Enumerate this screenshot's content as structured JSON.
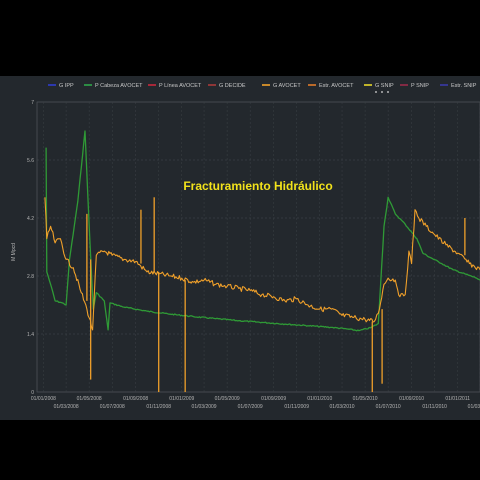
{
  "chart_data": {
    "type": "line",
    "title": "",
    "ylabel": "M Mpcd",
    "xlabel": "",
    "ylim": [
      0,
      7
    ],
    "yticks": [
      0,
      1.4,
      2.8,
      4.2,
      5.6,
      7
    ],
    "ytick_labels": [
      "0",
      "1.4",
      "2.8",
      "4.2",
      "5.6",
      "7"
    ],
    "xlim": [
      "2007-12-15",
      "2011-03-01"
    ],
    "xticks_row1": [
      "01/01/2008",
      "01/05/2008",
      "01/09/2008",
      "01/01/2009",
      "01/05/2009",
      "01/09/2009",
      "01/01/2010",
      "01/05/2010",
      "01/09/2010",
      "01/01/2011"
    ],
    "xticks_row2": [
      "01/03/2008",
      "01/07/2008",
      "01/11/2008",
      "01/03/2009",
      "01/07/2009",
      "01/11/2009",
      "01/03/2010",
      "01/07/2010",
      "01/11/2010",
      "01/03/2011"
    ],
    "grid": true,
    "legend_position": "top",
    "legend": [
      {
        "name": "G IPP",
        "color": "#2f3ccf"
      },
      {
        "name": "P Cabeza AVOCET",
        "color": "#2ea64a"
      },
      {
        "name": "P Línea AVOCET",
        "color": "#c8283c"
      },
      {
        "name": "G DECIDE",
        "color": "#a93a3a"
      },
      {
        "name": "G AVOCET",
        "color": "#f0a02a"
      },
      {
        "name": "Estr. AVOCET",
        "color": "#e07a2a"
      },
      {
        "name": "G SNIP",
        "color": "#e6d82a"
      },
      {
        "name": "P SNIP",
        "color": "#9a2a4a"
      },
      {
        "name": "Estr. SNIP",
        "color": "#3a3aa8"
      }
    ],
    "annotation": "Fracturamiento Hidráulico",
    "series": [
      {
        "name": "P Cabeza AVOCET",
        "color": "#2f9a36",
        "points": [
          [
            "2008-01-08",
            5.9
          ],
          [
            "2008-01-10",
            2.9
          ],
          [
            "2008-01-20",
            2.6
          ],
          [
            "2008-02-01",
            2.2
          ],
          [
            "2008-02-20",
            2.15
          ],
          [
            "2008-03-01",
            2.1
          ],
          [
            "2008-03-10",
            3.2
          ],
          [
            "2008-04-01",
            4.6
          ],
          [
            "2008-04-20",
            6.3
          ],
          [
            "2008-05-01",
            4.0
          ],
          [
            "2008-05-12",
            2.0
          ],
          [
            "2008-05-20",
            2.4
          ],
          [
            "2008-06-10",
            2.2
          ],
          [
            "2008-06-20",
            1.5
          ],
          [
            "2008-06-25",
            2.15
          ],
          [
            "2008-08-01",
            2.05
          ],
          [
            "2008-10-01",
            1.95
          ],
          [
            "2008-12-01",
            1.88
          ],
          [
            "2009-02-01",
            1.82
          ],
          [
            "2009-04-01",
            1.77
          ],
          [
            "2009-06-01",
            1.72
          ],
          [
            "2009-08-01",
            1.68
          ],
          [
            "2009-10-01",
            1.64
          ],
          [
            "2009-12-01",
            1.6
          ],
          [
            "2010-02-01",
            1.56
          ],
          [
            "2010-03-15",
            1.52
          ],
          [
            "2010-04-15",
            1.48
          ],
          [
            "2010-05-15",
            1.55
          ],
          [
            "2010-06-05",
            1.65
          ],
          [
            "2010-06-20",
            4.0
          ],
          [
            "2010-07-01",
            4.7
          ],
          [
            "2010-07-20",
            4.3
          ],
          [
            "2010-08-15",
            4.05
          ],
          [
            "2010-09-15",
            3.7
          ],
          [
            "2010-10-01",
            3.35
          ],
          [
            "2010-10-20",
            3.25
          ],
          [
            "2010-11-20",
            3.1
          ],
          [
            "2010-12-20",
            2.95
          ],
          [
            "2011-01-20",
            2.85
          ],
          [
            "2011-02-20",
            2.75
          ],
          [
            "2011-03-01",
            2.7
          ]
        ]
      },
      {
        "name": "G AVOCET",
        "color": "#f0a02a",
        "points": [
          [
            "2008-01-05",
            4.7
          ],
          [
            "2008-01-10",
            3.7
          ],
          [
            "2008-01-20",
            4.0
          ],
          [
            "2008-02-01",
            3.6
          ],
          [
            "2008-02-15",
            3.7
          ],
          [
            "2008-03-01",
            3.2
          ],
          [
            "2008-03-20",
            3.0
          ],
          [
            "2008-04-10",
            2.4
          ],
          [
            "2008-04-25",
            2.0
          ],
          [
            "2008-05-10",
            1.5
          ],
          [
            "2008-05-20",
            3.3
          ],
          [
            "2008-06-10",
            3.4
          ],
          [
            "2008-07-01",
            3.3
          ],
          [
            "2008-08-01",
            3.2
          ],
          [
            "2008-09-01",
            3.15
          ],
          [
            "2008-10-01",
            2.9
          ],
          [
            "2008-11-01",
            2.85
          ],
          [
            "2008-12-01",
            2.8
          ],
          [
            "2009-01-01",
            2.75
          ],
          [
            "2009-02-01",
            2.65
          ],
          [
            "2009-03-01",
            2.7
          ],
          [
            "2009-04-01",
            2.6
          ],
          [
            "2009-05-01",
            2.55
          ],
          [
            "2009-06-01",
            2.5
          ],
          [
            "2009-07-01",
            2.45
          ],
          [
            "2009-08-01",
            2.35
          ],
          [
            "2009-09-01",
            2.3
          ],
          [
            "2009-10-01",
            2.2
          ],
          [
            "2009-11-01",
            2.25
          ],
          [
            "2009-12-01",
            2.1
          ],
          [
            "2010-01-01",
            2.0
          ],
          [
            "2010-02-01",
            2.0
          ],
          [
            "2010-03-01",
            1.85
          ],
          [
            "2010-04-01",
            1.8
          ],
          [
            "2010-05-01",
            1.75
          ],
          [
            "2010-05-25",
            1.7
          ],
          [
            "2010-06-05",
            1.9
          ],
          [
            "2010-06-20",
            2.6
          ],
          [
            "2010-07-01",
            2.75
          ],
          [
            "2010-07-20",
            2.7
          ],
          [
            "2010-08-01",
            2.3
          ],
          [
            "2010-08-15",
            2.35
          ],
          [
            "2010-08-25",
            3.4
          ],
          [
            "2010-09-01",
            3.1
          ],
          [
            "2010-09-10",
            4.4
          ],
          [
            "2010-09-20",
            4.2
          ],
          [
            "2010-10-10",
            4.0
          ],
          [
            "2010-11-01",
            3.8
          ],
          [
            "2010-12-01",
            3.55
          ],
          [
            "2011-01-01",
            3.35
          ],
          [
            "2011-02-01",
            3.1
          ],
          [
            "2011-03-01",
            2.95
          ]
        ]
      }
    ],
    "spikes": [
      {
        "series": "G AVOCET",
        "date": "2008-04-25",
        "from": 2.2,
        "to": 4.3
      },
      {
        "series": "G AVOCET",
        "date": "2008-05-05",
        "from": 3.2,
        "to": 0.3
      },
      {
        "series": "G AVOCET",
        "date": "2008-09-15",
        "from": 3.1,
        "to": 4.4
      },
      {
        "series": "G AVOCET",
        "date": "2008-10-20",
        "from": 2.9,
        "to": 4.7
      },
      {
        "series": "G AVOCET",
        "date": "2008-11-01",
        "from": 2.9,
        "to": 0.0
      },
      {
        "series": "G AVOCET",
        "date": "2009-01-10",
        "from": 2.7,
        "to": 0.0
      },
      {
        "series": "G AVOCET",
        "date": "2010-05-20",
        "from": 1.7,
        "to": 0.0
      },
      {
        "series": "G AVOCET",
        "date": "2010-06-15",
        "from": 2.0,
        "to": 0.2
      },
      {
        "series": "G AVOCET",
        "date": "2011-01-20",
        "from": 3.3,
        "to": 4.2
      }
    ]
  }
}
